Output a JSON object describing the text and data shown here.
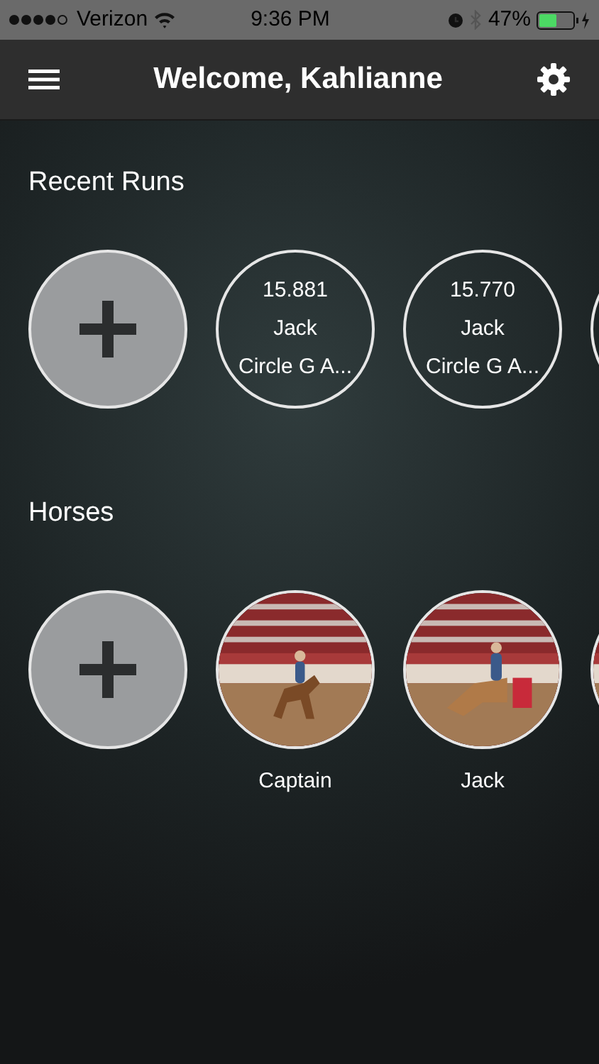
{
  "status_bar": {
    "carrier": "Verizon",
    "time": "9:36 PM",
    "battery": "47%"
  },
  "header": {
    "title": "Welcome, Kahlianne"
  },
  "sections": [
    {
      "title": "Recent Runs",
      "kind": "runs",
      "items": [
        {
          "kind": "add"
        },
        {
          "kind": "run",
          "lines": [
            "15.881",
            "Jack",
            "Circle G A..."
          ]
        },
        {
          "kind": "run",
          "lines": [
            "15.770",
            "Jack",
            "Circle G A..."
          ]
        },
        {
          "kind": "run"
        }
      ]
    },
    {
      "title": "Horses",
      "kind": "horses",
      "items": [
        {
          "kind": "add"
        },
        {
          "kind": "picture",
          "name": "Captain"
        },
        {
          "kind": "picture",
          "name": "Jack"
        },
        {
          "kind": "picture"
        }
      ]
    }
  ]
}
